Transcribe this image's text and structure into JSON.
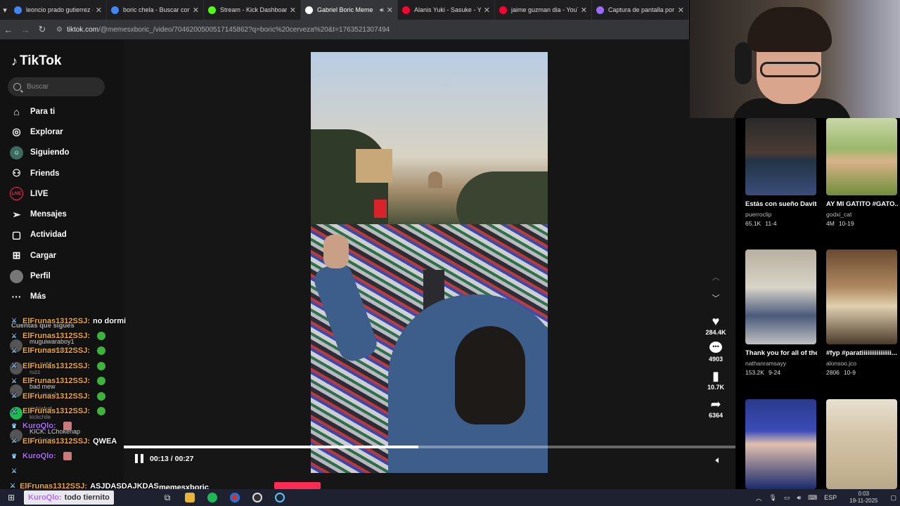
{
  "browser": {
    "tabs": [
      {
        "label": "leoncio prado gutierrez -",
        "icon": "google-icon",
        "color": "#4285f4"
      },
      {
        "label": "boric chela - Buscar con G",
        "icon": "google-icon",
        "color": "#4285f4"
      },
      {
        "label": "Stream - Kick Dashboard",
        "icon": "kick-icon",
        "color": "#53fc18"
      },
      {
        "label": "Gabriel Boric Meme",
        "icon": "tiktok-icon",
        "color": "#ffffff",
        "active": true
      },
      {
        "label": "Alanis Yuki - Sasuke - You",
        "icon": "youtube-icon",
        "color": "#ff0033"
      },
      {
        "label": "jaime guzman dia - YouTu",
        "icon": "youtube-icon",
        "color": "#ff0033"
      },
      {
        "label": "Captura de pantalla por L",
        "icon": "pen-icon",
        "color": "#9b6bff"
      }
    ],
    "tab_close": "✕",
    "url_host": "tiktok.com",
    "url_path": "/@memesxboric_/video/7046200500517145862?q=boric%20cerveza%20&t=1763521307494"
  },
  "sidebar": {
    "logo": "TikTok",
    "search_placeholder": "Buscar",
    "items": [
      {
        "label": "Para ti",
        "icon": "home-icon",
        "glyph": "⌂"
      },
      {
        "label": "Explorar",
        "icon": "compass-icon",
        "glyph": "◎"
      },
      {
        "label": "Siguiendo",
        "icon": "following-avatar-icon",
        "glyph": "☺"
      },
      {
        "label": "Friends",
        "icon": "friends-icon",
        "glyph": "⚇"
      },
      {
        "label": "LIVE",
        "icon": "live-icon",
        "glyph": "LIVE"
      },
      {
        "label": "Mensajes",
        "icon": "send-icon",
        "glyph": "➢"
      },
      {
        "label": "Actividad",
        "icon": "activity-icon",
        "glyph": "▢"
      },
      {
        "label": "Cargar",
        "icon": "upload-icon",
        "glyph": "⊞"
      },
      {
        "label": "Perfil",
        "icon": "profile-icon",
        "glyph": ""
      },
      {
        "label": "Más",
        "icon": "more-icon",
        "glyph": "···"
      }
    ],
    "following_header": "Cuentas que sigues",
    "following": [
      {
        "name": "muguiwaraboy1",
        "sub": "muguiwaraboy1"
      },
      {
        "name": "im_ruzz",
        "sub": "ruzz"
      },
      {
        "name": "bad mew",
        "sub": "bad_mew1"
      },
      {
        "name": "tiokickcl",
        "sub": "kickchile"
      },
      {
        "name": "KICK: LChokenap",
        "sub": "lchokenap"
      }
    ]
  },
  "player": {
    "time": "00:13 / 00:27",
    "progress": 0.4815,
    "author": "memesxboric_",
    "likes": "284.4K",
    "comments": "4903",
    "saves": "10.7K",
    "shares": "6364"
  },
  "recommendations": [
    {
      "title": "Estás con sueño Davito?...",
      "user": "puerroclip",
      "views": "65.1K",
      "date": "11-4",
      "thumb": "stake-thumbnail"
    },
    {
      "title": "AY MI GATITO #GATO...",
      "user": "godxi_cat",
      "views": "4M",
      "date": "10-19",
      "thumb": "cat-thumbnail"
    },
    {
      "title": "Thank you for all of the love guys, I real...",
      "user": "nathanramsayy",
      "views": "153.2K",
      "date": "9-24",
      "thumb": "dance-thumbnail"
    },
    {
      "title": "#fyp #paratiiiiiiiiiiiiiiii...",
      "user": "alonsoo.jco",
      "views": "2806",
      "date": "10-9",
      "thumb": "restaurant-thumbnail"
    },
    {
      "title": "",
      "user": "",
      "views": "",
      "date": "",
      "thumb": "kast-thumbnail"
    },
    {
      "title": "",
      "user": "",
      "views": "",
      "date": "",
      "thumb": "counter-strike-thumbnail"
    }
  ],
  "chat": [
    {
      "user": "ElFrunas1312SSJ:",
      "msg": "no dormi",
      "badge": "sword-badge",
      "emote": ""
    },
    {
      "user": "ElFrunas1312SSJ:",
      "msg": "",
      "badge": "sword-badge",
      "emote": "green-emote"
    },
    {
      "user": "ElFrunas1312SSJ:",
      "msg": "",
      "badge": "sword-badge",
      "emote": "green-emote"
    },
    {
      "user": "ElFrunas1312SSJ:",
      "msg": "",
      "badge": "sword-badge",
      "emote": "green-emote"
    },
    {
      "user": "ElFrunas1312SSJ:",
      "msg": "",
      "badge": "sword-badge",
      "emote": "green-emote"
    },
    {
      "user": "ElFrunas1312SSJ:",
      "msg": "",
      "badge": "sword-badge",
      "emote": "green-emote"
    },
    {
      "user": "ElFrunas1312SSJ:",
      "msg": "",
      "badge": "sword-badge",
      "emote": "green-emote"
    },
    {
      "user": "KuroQlo:",
      "msg": "",
      "badge": "crown-badge",
      "emote": "pink-emote",
      "kuro": true
    },
    {
      "user": "ElFrunas1312SSJ:",
      "msg": "QWEA",
      "badge": "sword-badge",
      "emote": ""
    },
    {
      "user": "KuroQlo:",
      "msg": "",
      "badge": "crown-badge",
      "emote": "pink-emote",
      "kuro": true
    },
    {
      "user": "",
      "msg": "",
      "badge": "sword-badge",
      "emote": ""
    },
    {
      "user": "ElFrunas1312SSJ:",
      "msg": "ASJDASDAJKDAS",
      "badge": "sword-badge",
      "emote": ""
    }
  ],
  "toast": {
    "user": "KuroQlo:",
    "msg": "todo tiernito"
  },
  "taskbar": {
    "lang": "ESP",
    "time": "0:03",
    "date": "19-11-2025"
  }
}
